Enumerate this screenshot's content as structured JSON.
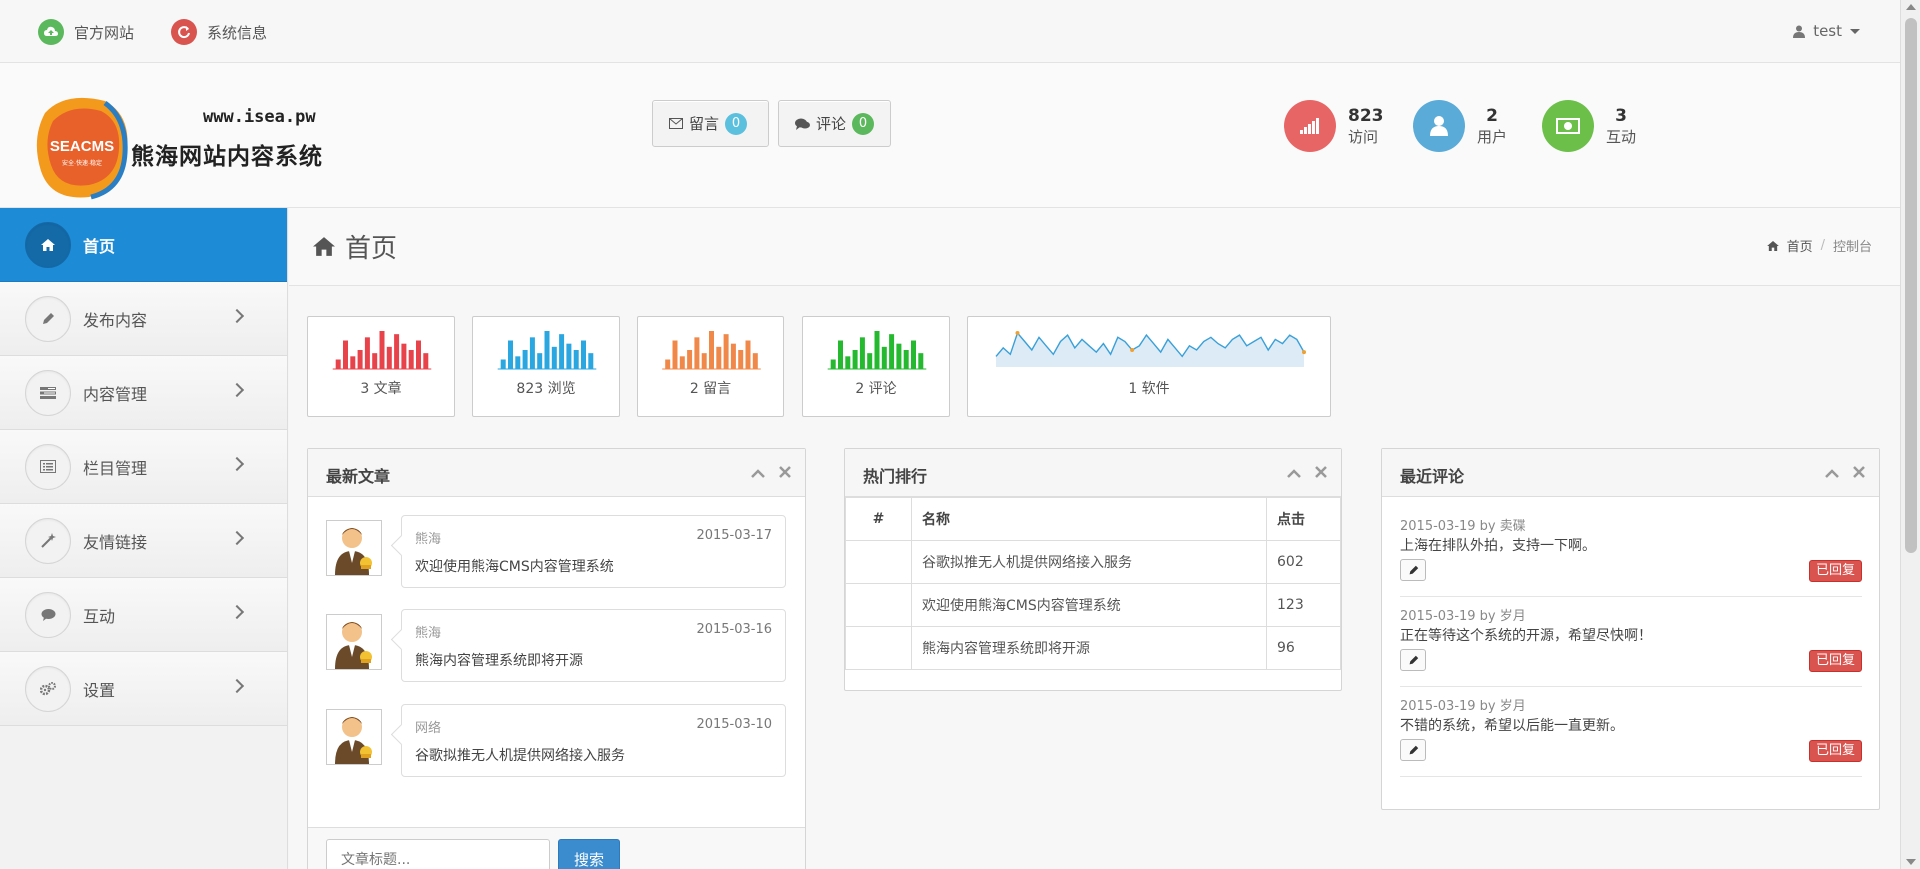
{
  "topbar": {
    "links": [
      {
        "label": "官方网站",
        "icon": "cloud-upload-icon",
        "color": "#5cb85c"
      },
      {
        "label": "系统信息",
        "icon": "refresh-icon",
        "color": "#d9534f"
      }
    ],
    "user": "test"
  },
  "header": {
    "logo_text": "SEACMS",
    "logo_tagline": "安全·快速·稳定",
    "url": "www.isea.pw",
    "site_title": "熊海网站内容系统",
    "message_btn": {
      "label": "留言",
      "count": "0",
      "icon": "envelope-icon",
      "badge_color": "#5bc0de"
    },
    "comment_btn": {
      "label": "评论",
      "count": "0",
      "icon": "comments-icon",
      "badge_color": "#5cb85c"
    },
    "stats": [
      {
        "value": "823",
        "label": "访问",
        "icon": "signal-icon",
        "color": "#e86565"
      },
      {
        "value": "2",
        "label": "用户",
        "icon": "user-icon",
        "color": "#5aabd8"
      },
      {
        "value": "3",
        "label": "互动",
        "icon": "money-icon",
        "color": "#6cc04a"
      }
    ]
  },
  "sidebar": {
    "items": [
      {
        "label": "首页",
        "icon": "home-icon",
        "active": true
      },
      {
        "label": "发布内容",
        "icon": "pencil-icon"
      },
      {
        "label": "内容管理",
        "icon": "tasks-icon"
      },
      {
        "label": "栏目管理",
        "icon": "list-alt-icon"
      },
      {
        "label": "友情链接",
        "icon": "magic-icon"
      },
      {
        "label": "互动",
        "icon": "comments-icon"
      },
      {
        "label": "设置",
        "icon": "cogs-icon"
      }
    ]
  },
  "page": {
    "title": "首页",
    "breadcrumb": [
      "首页",
      "控制台"
    ]
  },
  "mini_stats": [
    {
      "label": "3 文章",
      "color": "#e8434b",
      "bars": [
        3,
        9,
        4,
        6,
        10,
        5,
        12,
        7,
        11,
        8,
        6,
        9,
        5
      ]
    },
    {
      "label": "823 浏览",
      "color": "#2aa6e0",
      "bars": [
        3,
        9,
        4,
        6,
        10,
        5,
        12,
        7,
        11,
        8,
        6,
        9,
        5
      ]
    },
    {
      "label": "2 留言",
      "color": "#f0884a",
      "bars": [
        3,
        9,
        4,
        6,
        10,
        5,
        12,
        7,
        11,
        8,
        6,
        9,
        5
      ]
    },
    {
      "label": "2 评论",
      "color": "#24b92f",
      "bars": [
        3,
        9,
        4,
        6,
        10,
        5,
        12,
        7,
        11,
        8,
        6,
        9,
        5
      ]
    },
    {
      "label": "1 软件",
      "color": "#3aa0d8",
      "line": [
        5,
        9,
        6,
        16,
        12,
        8,
        14,
        10,
        6,
        12,
        15,
        9,
        13,
        10,
        7,
        11,
        6,
        14,
        12,
        8,
        10,
        15,
        11,
        7,
        13,
        9,
        5,
        10,
        8,
        12,
        14,
        11,
        9,
        13,
        15,
        10,
        12,
        14,
        8,
        13,
        11,
        15,
        13,
        7
      ]
    }
  ],
  "latest_articles": {
    "title": "最新文章",
    "items": [
      {
        "category": "熊海",
        "date": "2015-03-17",
        "title": "欢迎使用熊海CMS内容管理系统"
      },
      {
        "category": "熊海",
        "date": "2015-03-16",
        "title": "熊海内容管理系统即将开源"
      },
      {
        "category": "网络",
        "date": "2015-03-10",
        "title": "谷歌拟推无人机提供网络接入服务"
      }
    ],
    "search_placeholder": "文章标题...",
    "search_button": "搜索"
  },
  "hot_rank": {
    "title": "热门排行",
    "columns": [
      "#",
      "名称",
      "点击"
    ],
    "rows": [
      {
        "idx": "",
        "name": "谷歌拟推无人机提供网络接入服务",
        "clicks": "602"
      },
      {
        "idx": "",
        "name": "欢迎使用熊海CMS内容管理系统",
        "clicks": "123"
      },
      {
        "idx": "",
        "name": "熊海内容管理系统即将开源",
        "clicks": "96"
      }
    ]
  },
  "recent_comments": {
    "title": "最近评论",
    "items": [
      {
        "meta": "2015-03-19 by 卖碟",
        "text": "上海在排队外拍，支持一下啊。",
        "status": "已回复"
      },
      {
        "meta": "2015-03-19 by 岁月",
        "text": "正在等待这个系统的开源，希望尽快啊！",
        "status": "已回复"
      },
      {
        "meta": "2015-03-19 by 岁月",
        "text": "不错的系统，希望以后能一直更新。",
        "status": "已回复"
      }
    ]
  }
}
